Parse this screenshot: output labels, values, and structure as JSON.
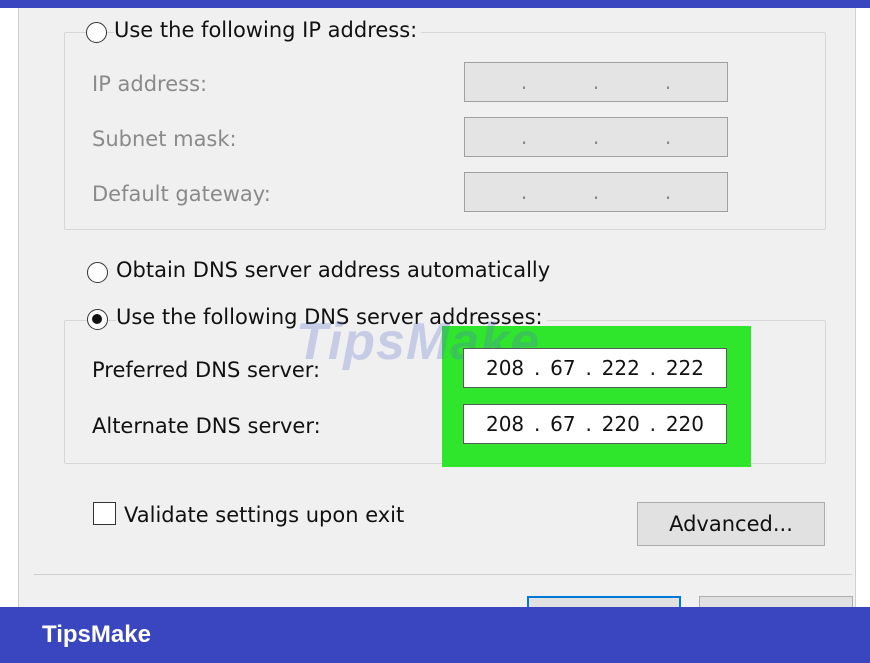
{
  "ip_section": {
    "radio_label": "Use the following IP address:",
    "ip_address_label": "IP address:",
    "subnet_mask_label": "Subnet mask:",
    "default_gateway_label": "Default gateway:",
    "empty_octet_separator": "."
  },
  "dns_section": {
    "auto_radio_label": "Obtain DNS server address automatically",
    "manual_radio_label": "Use the following DNS server addresses:",
    "preferred_label": "Preferred DNS server:",
    "preferred_octets": [
      "208",
      "67",
      "222",
      "222"
    ],
    "alternate_label": "Alternate DNS server:",
    "alternate_octets": [
      "208",
      "67",
      "220",
      "220"
    ],
    "highlight_color": "#2fe62c"
  },
  "footer_controls": {
    "validate_label": "Validate settings upon exit",
    "advanced_button": "Advanced..."
  },
  "branding": {
    "watermark": "TipsMake",
    "footer_brand": "TipsMake",
    "accent_color": "#3a46bf"
  }
}
